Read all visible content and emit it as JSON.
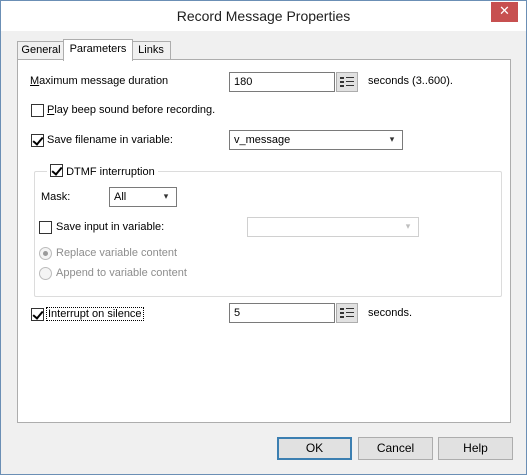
{
  "window": {
    "title": "Record Message Properties",
    "close_glyph": "✕"
  },
  "tabs": [
    {
      "label": "General",
      "active": false
    },
    {
      "label": "Parameters",
      "active": true
    },
    {
      "label": "Links",
      "active": false
    }
  ],
  "params": {
    "max_duration_label": "Maximum message duration",
    "max_duration_value": "180",
    "max_duration_unit": "seconds  (3..600).",
    "play_beep_label": "Play beep sound before recording.",
    "play_beep_checked": false,
    "save_filename_label": "Save filename in variable:",
    "save_filename_checked": true,
    "save_filename_value": "v_message",
    "dtmf_label": "DTMF interruption",
    "dtmf_checked": true,
    "mask_label": "Mask:",
    "mask_value": "All",
    "save_input_label": "Save input in variable:",
    "save_input_checked": false,
    "save_input_value": "",
    "replace_label": "Replace variable content",
    "append_label": "Append to variable content",
    "interrupt_silence_label": "Interrupt on silence",
    "interrupt_silence_checked": true,
    "silence_value": "5",
    "silence_unit": "seconds."
  },
  "buttons": {
    "ok": "OK",
    "cancel": "Cancel",
    "help": "Help"
  },
  "icons": {
    "list_picker": "list-picker-icon",
    "chevron": "chevron-down-icon"
  },
  "colors": {
    "close_button": "#c75050",
    "default_button_border": "#3c7fb1"
  }
}
